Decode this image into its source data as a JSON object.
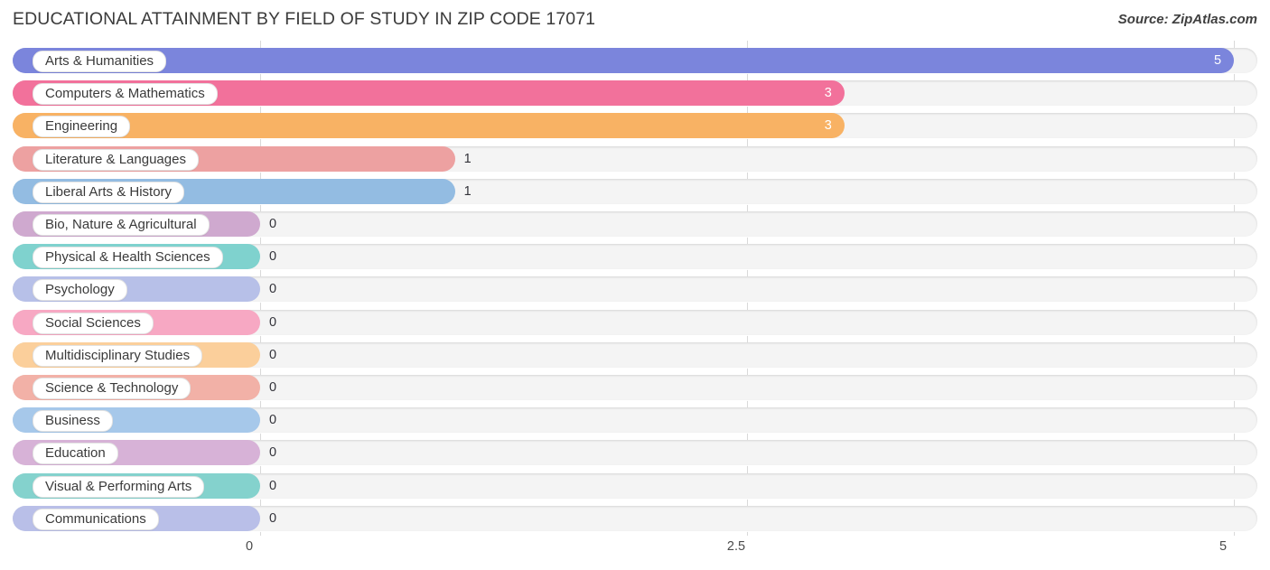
{
  "header": {
    "title": "EDUCATIONAL ATTAINMENT BY FIELD OF STUDY IN ZIP CODE 17071",
    "source": "Source: ZipAtlas.com"
  },
  "chart_data": {
    "type": "bar",
    "orientation": "horizontal",
    "title": "EDUCATIONAL ATTAINMENT BY FIELD OF STUDY IN ZIP CODE 17071",
    "xlabel": "",
    "ylabel": "",
    "xlim": [
      0,
      5
    ],
    "grid": true,
    "legend": "none",
    "ticks": [
      "0",
      "2.5",
      "5"
    ],
    "tick_values": [
      0,
      2.5,
      5
    ],
    "categories": [
      "Arts & Humanities",
      "Computers & Mathematics",
      "Engineering",
      "Literature & Languages",
      "Liberal Arts & History",
      "Bio, Nature & Agricultural",
      "Physical & Health Sciences",
      "Psychology",
      "Social Sciences",
      "Multidisciplinary Studies",
      "Science & Technology",
      "Business",
      "Education",
      "Visual & Performing Arts",
      "Communications"
    ],
    "values": [
      5,
      3,
      3,
      1,
      1,
      0,
      0,
      0,
      0,
      0,
      0,
      0,
      0,
      0,
      0
    ],
    "value_labels": [
      "5",
      "3",
      "3",
      "1",
      "1",
      "0",
      "0",
      "0",
      "0",
      "0",
      "0",
      "0",
      "0",
      "0",
      "0"
    ],
    "colors": [
      "#7b85dc",
      "#f2719b",
      "#f8b264",
      "#eda1a1",
      "#93bce2",
      "#cfa9cf",
      "#7fd2ce",
      "#b7c0e8",
      "#f7a8c3",
      "#fbcf9b",
      "#f2b1a7",
      "#a6c8ea",
      "#d7b2d7",
      "#84d2cd",
      "#b9bfe8"
    ]
  }
}
